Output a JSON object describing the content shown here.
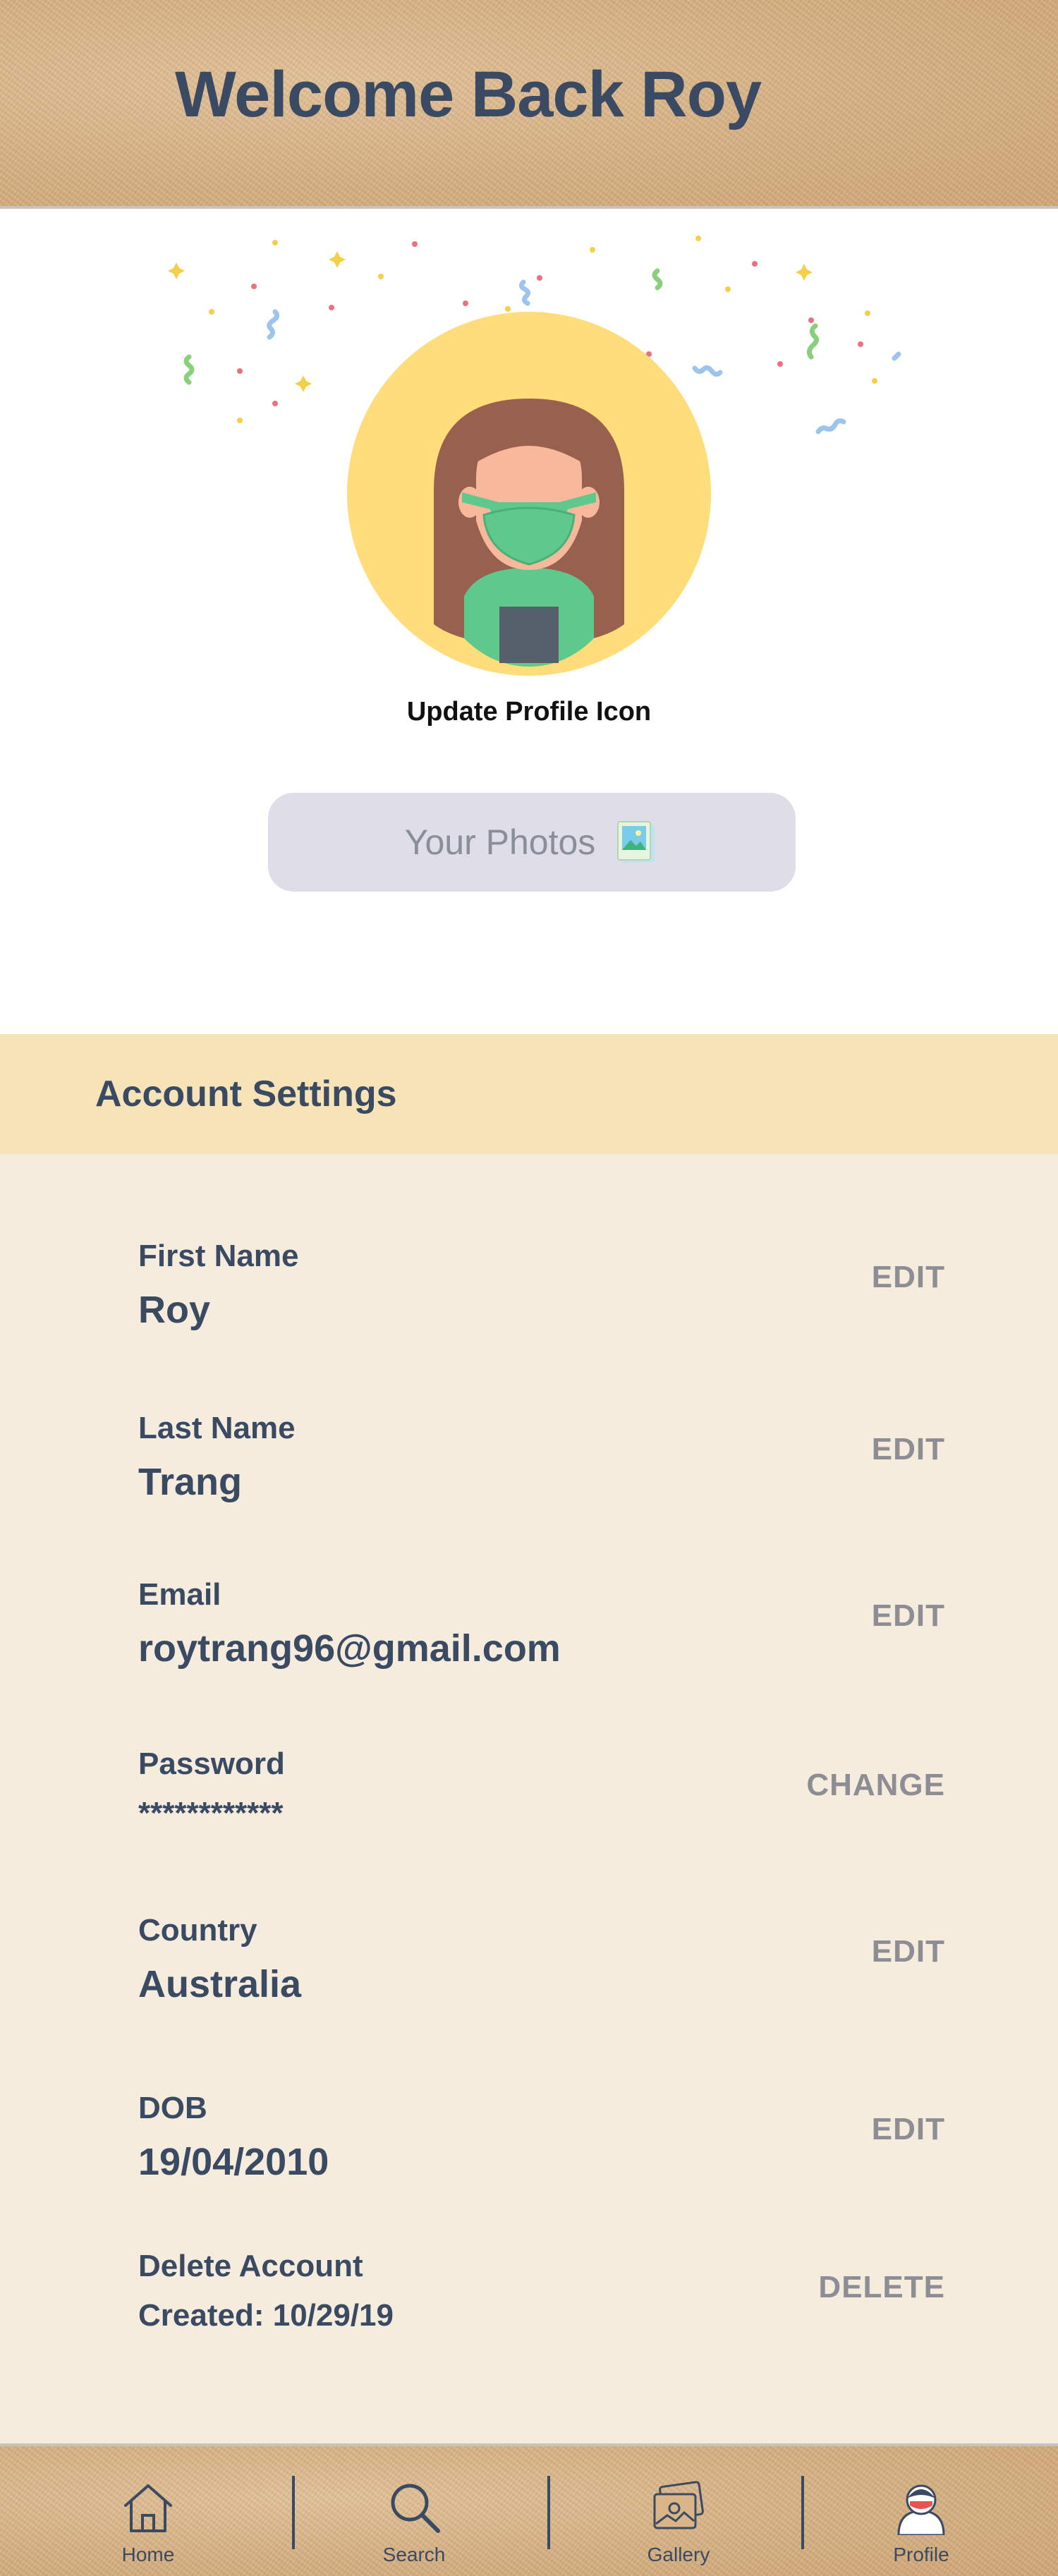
{
  "header": {
    "title": "Welcome Back Roy"
  },
  "profile": {
    "update_icon_label": "Update Profile Icon",
    "photos_button_label": "Your Photos"
  },
  "account_settings": {
    "title": "Account Settings",
    "rows": [
      {
        "label": "First Name",
        "value": "Roy",
        "action": "EDIT"
      },
      {
        "label": "Last Name",
        "value": "Trang",
        "action": "EDIT"
      },
      {
        "label": "Email",
        "value": "roytrang96@gmail.com",
        "action": "EDIT"
      },
      {
        "label": "Password",
        "value": "************",
        "action": "CHANGE"
      },
      {
        "label": "Country",
        "value": "Australia",
        "action": "EDIT"
      },
      {
        "label": "DOB",
        "value": "19/04/2010",
        "action": "EDIT"
      },
      {
        "label": "Delete Account",
        "value": "Created: 10/29/19",
        "action": "DELETE"
      }
    ]
  },
  "bottom_nav": {
    "items": [
      {
        "label": "Home",
        "icon": "home-icon"
      },
      {
        "label": "Search",
        "icon": "search-icon"
      },
      {
        "label": "Gallery",
        "icon": "gallery-icon"
      },
      {
        "label": "Profile",
        "icon": "profile-avatar-icon"
      }
    ]
  },
  "colors": {
    "text_primary": "#3a4a63",
    "action_gray": "#8d8d95",
    "settings_header_bg": "#f6e4b8",
    "settings_body_bg": "#f5ecdd",
    "photos_button_bg": "#dedde8",
    "avatar_circle": "#fedd7a",
    "mask_green": "#5fc88c"
  }
}
